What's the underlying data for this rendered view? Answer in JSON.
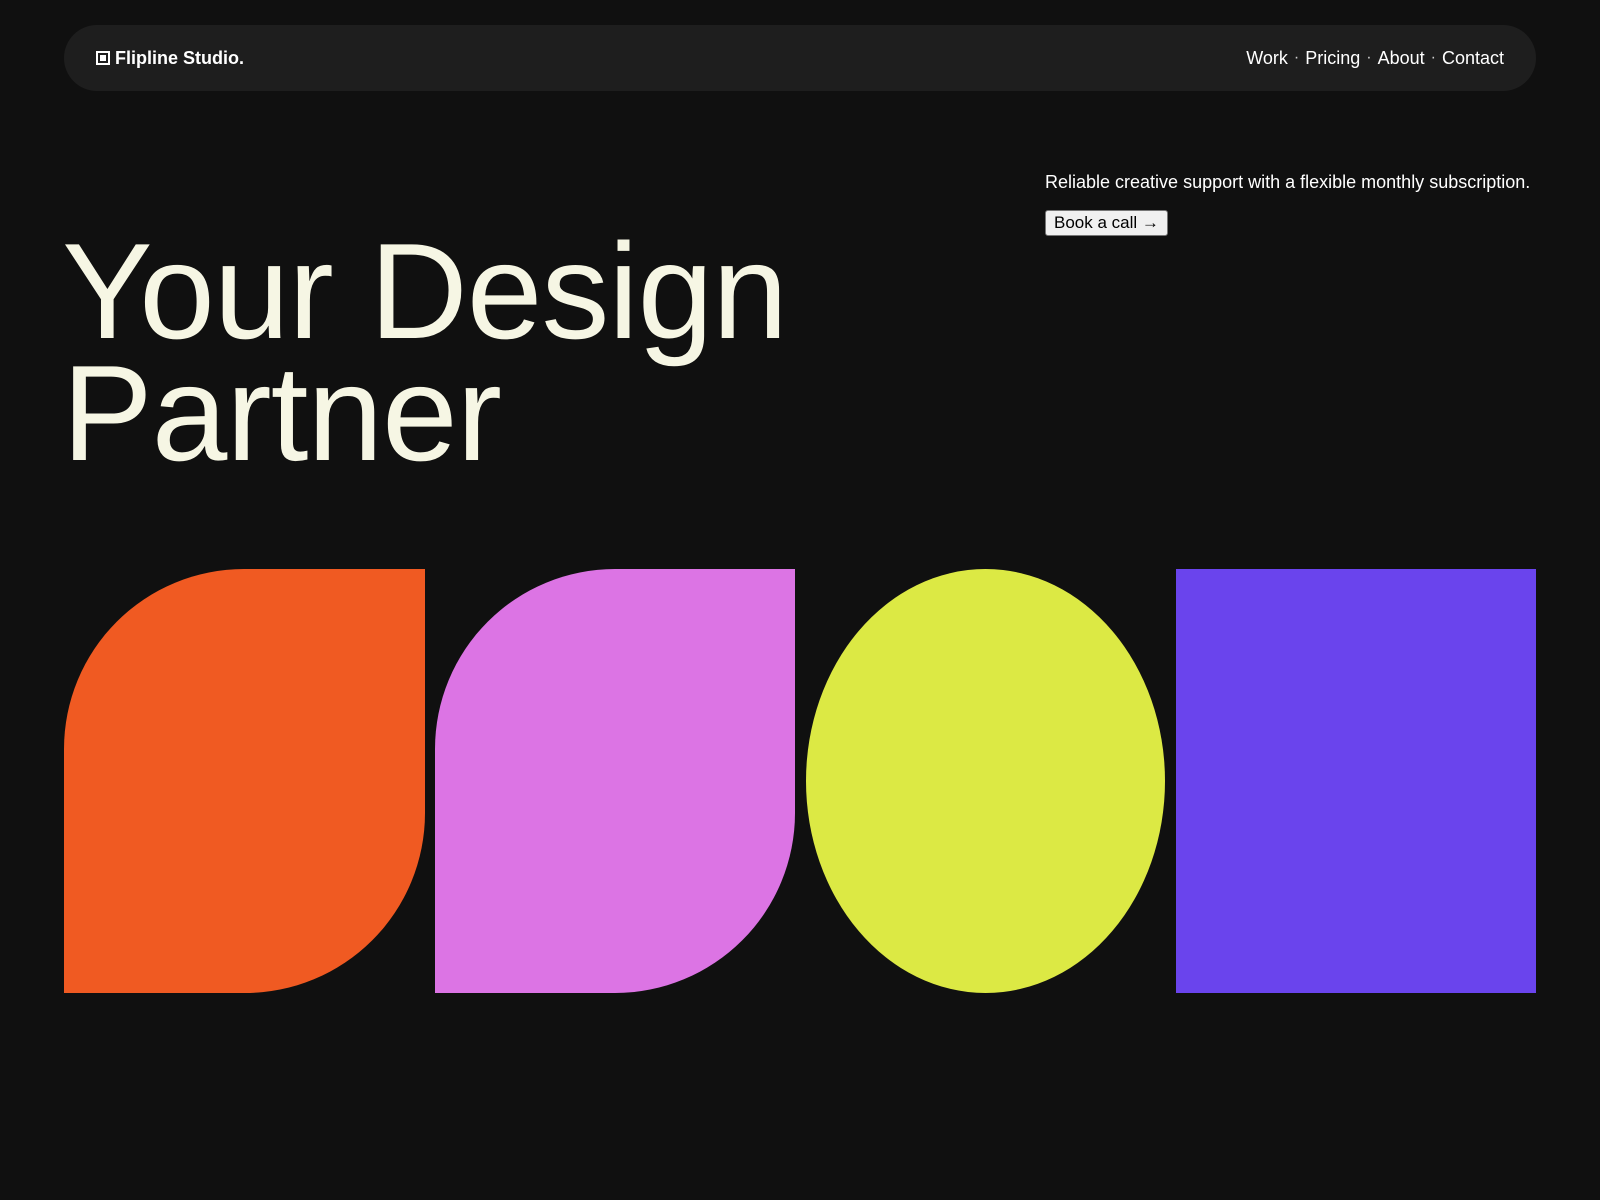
{
  "nav": {
    "brand": "Flipline Studio.",
    "links": [
      "Work",
      "Pricing",
      "About",
      "Contact"
    ],
    "separator": "·"
  },
  "hero": {
    "tagline": "Reliable creative support with a flexible monthly subscription.",
    "cta_label": "Book a call →",
    "title_line1": "Your Design",
    "title_line2": "Partner"
  },
  "shapes": {
    "orange": "#f05a22",
    "pink": "#dc74e4",
    "yellow": "#dce944",
    "purple": "#6a44ed"
  },
  "colors": {
    "background": "#101010",
    "navbar": "#1e1e1e",
    "title": "#f6f6e4"
  }
}
